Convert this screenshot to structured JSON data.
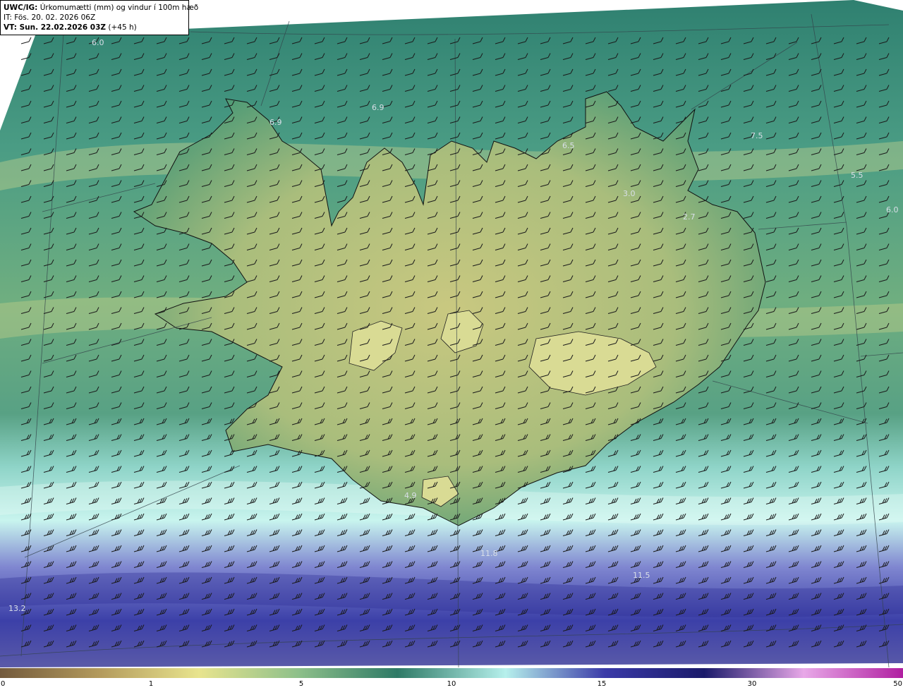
{
  "header": {
    "model_label": "UWC/IG:",
    "title": "Úrkomumætti (mm) og vindur í 100m hæð",
    "initial_time": "IT: Fös. 20. 02. 2026 06Z",
    "valid_label": "VT: Sun. 22.02.2026 03Z",
    "valid_offset": "(+45 h)"
  },
  "map": {
    "region": "Iceland",
    "field": "precipitable water (mm)",
    "overlay": "wind barbs at 100 m",
    "value_labels": [
      "6.0",
      "6.9",
      "6.9",
      "6.5",
      "7.5",
      "5.5",
      "6.0",
      "3.0",
      "2.7",
      "4.9",
      "11.8",
      "11.5",
      "13.2"
    ]
  },
  "colorbar": {
    "ticks": [
      "0",
      "1",
      "5",
      "10",
      "15",
      "30",
      "50"
    ],
    "colors": [
      "#735a3c",
      "#b39a5c",
      "#e8e48e",
      "#8ec08a",
      "#2e7a66",
      "#b6f0ec",
      "#3a3aa8",
      "#1a1a6a",
      "#e8a8e8",
      "#b01ea0"
    ]
  }
}
